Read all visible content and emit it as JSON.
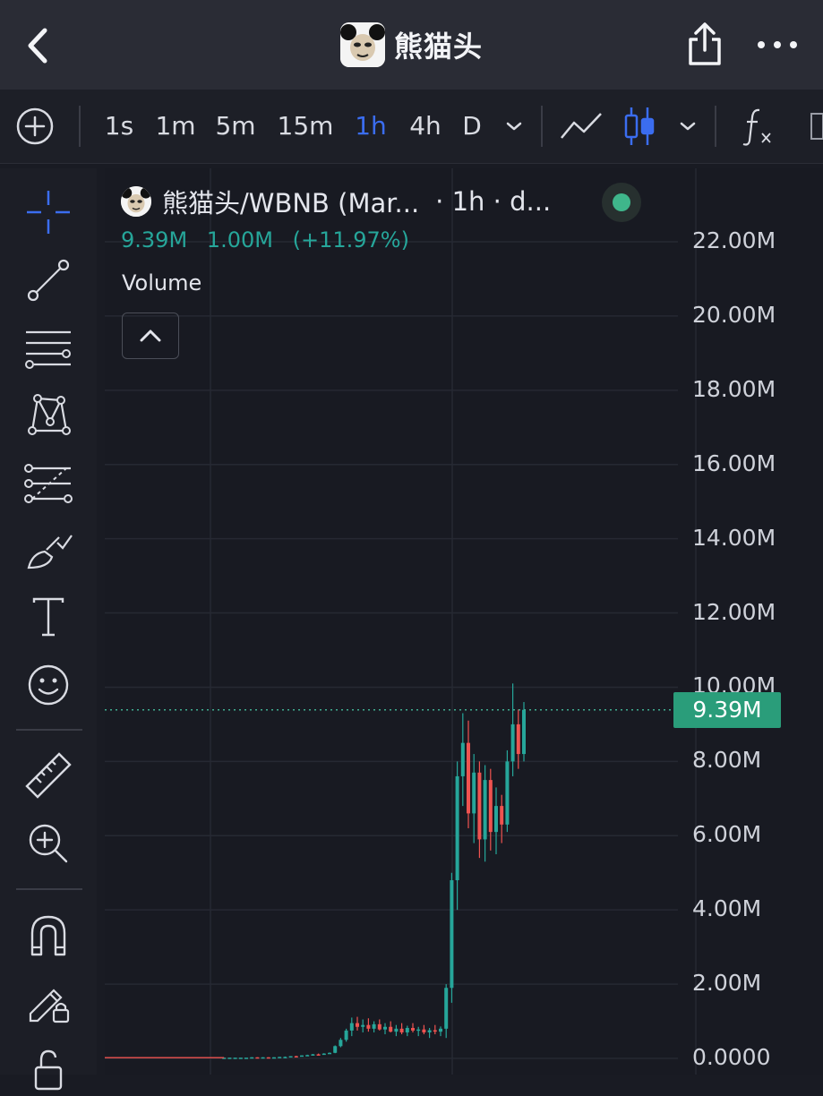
{
  "header": {
    "title": "熊猫头"
  },
  "toolbar": {
    "timeframes": [
      "1s",
      "1m",
      "5m",
      "15m",
      "1h",
      "4h",
      "D"
    ],
    "active_timeframe": "1h",
    "icons": [
      "add-indicator-icon",
      "timeframe-dropdown-icon",
      "line-chart-icon",
      "candlestick-icon",
      "chart-type-dropdown-icon",
      "function-icon"
    ]
  },
  "left_tools": [
    "crosshair-icon",
    "trend-line-icon",
    "horizontal-lines-icon",
    "pattern-icon",
    "fib-retracement-icon",
    "brush-icon",
    "text-icon",
    "emoji-icon",
    "ruler-icon",
    "zoom-in-icon",
    "magnet-icon",
    "lock-drawings-icon",
    "unlock-icon"
  ],
  "chart": {
    "legend": {
      "pair": "熊猫头/WBNB (Mar...",
      "interval": "· 1h · d..."
    },
    "values": {
      "v1": "9.39M",
      "v2": "1.00M",
      "v3": "(+11.97%)"
    },
    "volume_label": "Volume",
    "current_price_label": "9.39M"
  },
  "colors": {
    "up": "#26a69a",
    "down": "#ef5350",
    "accent": "#3b6df0",
    "price_tag": "#2a9d7a",
    "status": "#3fb68b"
  },
  "chart_data": {
    "type": "candlestick",
    "y_ticks": [
      "22.00M",
      "20.00M",
      "18.00M",
      "16.00M",
      "14.00M",
      "12.00M",
      "10.00M",
      "8.00M",
      "6.00M",
      "4.00M",
      "2.00M",
      "0.0000"
    ],
    "ylim": [
      0,
      22000000
    ],
    "current_value": 9390000,
    "series": [
      {
        "values": [
          [
            0.02,
            0.02,
            0.02,
            0.02
          ],
          [
            0.02,
            0.02,
            0.02,
            0.02
          ],
          [
            0.02,
            0.02,
            0.02,
            0.02
          ],
          [
            0.02,
            0.02,
            0.02,
            0.02
          ],
          [
            0.02,
            0.02,
            0.02,
            0.02
          ],
          [
            0.02,
            0.03,
            0.02,
            0.03
          ],
          [
            0.03,
            0.03,
            0.02,
            0.02
          ],
          [
            0.02,
            0.03,
            0.02,
            0.03
          ],
          [
            0.03,
            0.03,
            0.02,
            0.02
          ],
          [
            0.02,
            0.03,
            0.02,
            0.03
          ],
          [
            0.03,
            0.04,
            0.03,
            0.04
          ],
          [
            0.04,
            0.05,
            0.03,
            0.04
          ],
          [
            0.04,
            0.06,
            0.04,
            0.06
          ],
          [
            0.06,
            0.07,
            0.05,
            0.05
          ],
          [
            0.05,
            0.08,
            0.05,
            0.08
          ],
          [
            0.08,
            0.1,
            0.07,
            0.09
          ],
          [
            0.09,
            0.12,
            0.08,
            0.11
          ],
          [
            0.11,
            0.13,
            0.09,
            0.1
          ],
          [
            0.1,
            0.14,
            0.1,
            0.13
          ],
          [
            0.13,
            0.16,
            0.12,
            0.15
          ],
          [
            0.15,
            0.35,
            0.14,
            0.33
          ],
          [
            0.33,
            0.55,
            0.3,
            0.5
          ],
          [
            0.5,
            0.8,
            0.45,
            0.75
          ],
          [
            0.75,
            1.1,
            0.6,
            0.95
          ],
          [
            0.95,
            1.12,
            0.75,
            0.85
          ],
          [
            0.85,
            1.05,
            0.7,
            0.9
          ],
          [
            0.9,
            1.08,
            0.72,
            0.8
          ],
          [
            0.8,
            1.0,
            0.7,
            0.92
          ],
          [
            0.92,
            1.05,
            0.75,
            0.78
          ],
          [
            0.78,
            0.95,
            0.65,
            0.85
          ],
          [
            0.85,
            1.0,
            0.7,
            0.72
          ],
          [
            0.72,
            0.9,
            0.6,
            0.8
          ],
          [
            0.8,
            0.95,
            0.65,
            0.7
          ],
          [
            0.7,
            0.88,
            0.6,
            0.82
          ],
          [
            0.82,
            0.95,
            0.7,
            0.75
          ],
          [
            0.75,
            0.85,
            0.6,
            0.78
          ],
          [
            0.78,
            0.9,
            0.65,
            0.7
          ],
          [
            0.7,
            0.82,
            0.55,
            0.76
          ],
          [
            0.76,
            0.9,
            0.65,
            0.72
          ],
          [
            0.72,
            0.86,
            0.6,
            0.8
          ],
          [
            0.8,
            2.0,
            0.55,
            1.9
          ],
          [
            1.9,
            5.0,
            1.5,
            4.8
          ],
          [
            4.8,
            8.0,
            4.0,
            7.6
          ],
          [
            7.6,
            9.3,
            6.8,
            8.5
          ],
          [
            8.5,
            9.1,
            6.2,
            6.6
          ],
          [
            6.6,
            8.2,
            5.8,
            7.7
          ],
          [
            7.7,
            8.0,
            5.4,
            5.9
          ],
          [
            5.9,
            7.9,
            5.3,
            7.5
          ],
          [
            7.5,
            7.8,
            5.6,
            6.1
          ],
          [
            6.1,
            7.3,
            5.5,
            6.8
          ],
          [
            6.8,
            7.1,
            5.8,
            6.3
          ],
          [
            6.3,
            8.3,
            6.1,
            8.0
          ],
          [
            8.0,
            10.1,
            7.6,
            9.0
          ],
          [
            9.0,
            9.4,
            7.8,
            8.2
          ],
          [
            8.2,
            9.6,
            8.0,
            9.39
          ]
        ]
      }
    ]
  }
}
